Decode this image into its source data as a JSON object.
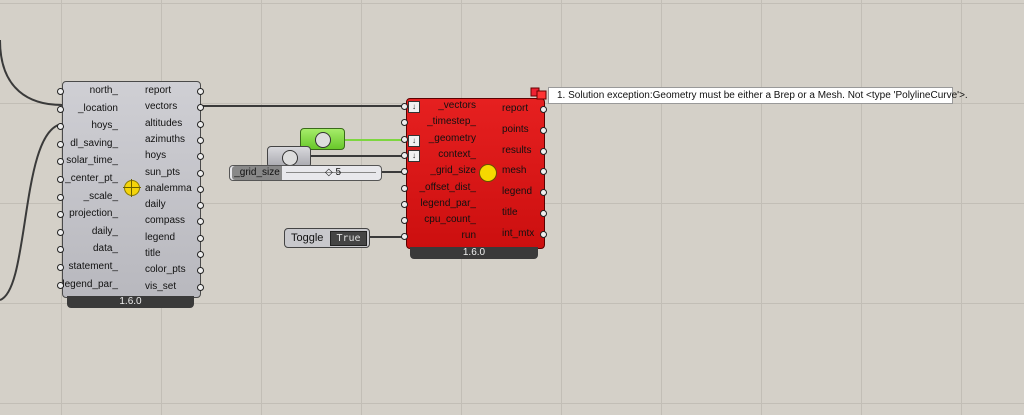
{
  "sunpath": {
    "inputs": [
      "north_",
      "_location",
      "hoys_",
      "dl_saving_",
      "solar_time_",
      "_center_pt_",
      "_scale_",
      "projection_",
      "daily_",
      "data_",
      "statement_",
      "legend_par_"
    ],
    "outputs": [
      "report",
      "vectors",
      "altitudes",
      "azimuths",
      "hoys",
      "sun_pts",
      "analemma",
      "daily",
      "compass",
      "legend",
      "title",
      "color_pts",
      "vis_set"
    ],
    "version": "1.6.0"
  },
  "radiation": {
    "inputs": [
      "_vectors",
      "_timestep_",
      "_geometry",
      "context_",
      "_grid_size",
      "_offset_dist_",
      "legend_par_",
      "cpu_count_",
      "run"
    ],
    "outputs": [
      "report",
      "points",
      "results",
      "mesh",
      "legend",
      "title",
      "int_mtx"
    ],
    "version": "1.6.0"
  },
  "error": {
    "message": "1. Solution exception:Geometry must be either a Brep or a Mesh. Not <type 'PolylineCurve'>."
  },
  "grid_size_slider": {
    "label": "_grid_size",
    "value": "◇ 5"
  },
  "toggle": {
    "label": "Toggle",
    "value": "True"
  },
  "colors": {
    "canvas": "#d4d0c8",
    "error_component": "#e01818",
    "geometry_param": "#7ed640"
  }
}
